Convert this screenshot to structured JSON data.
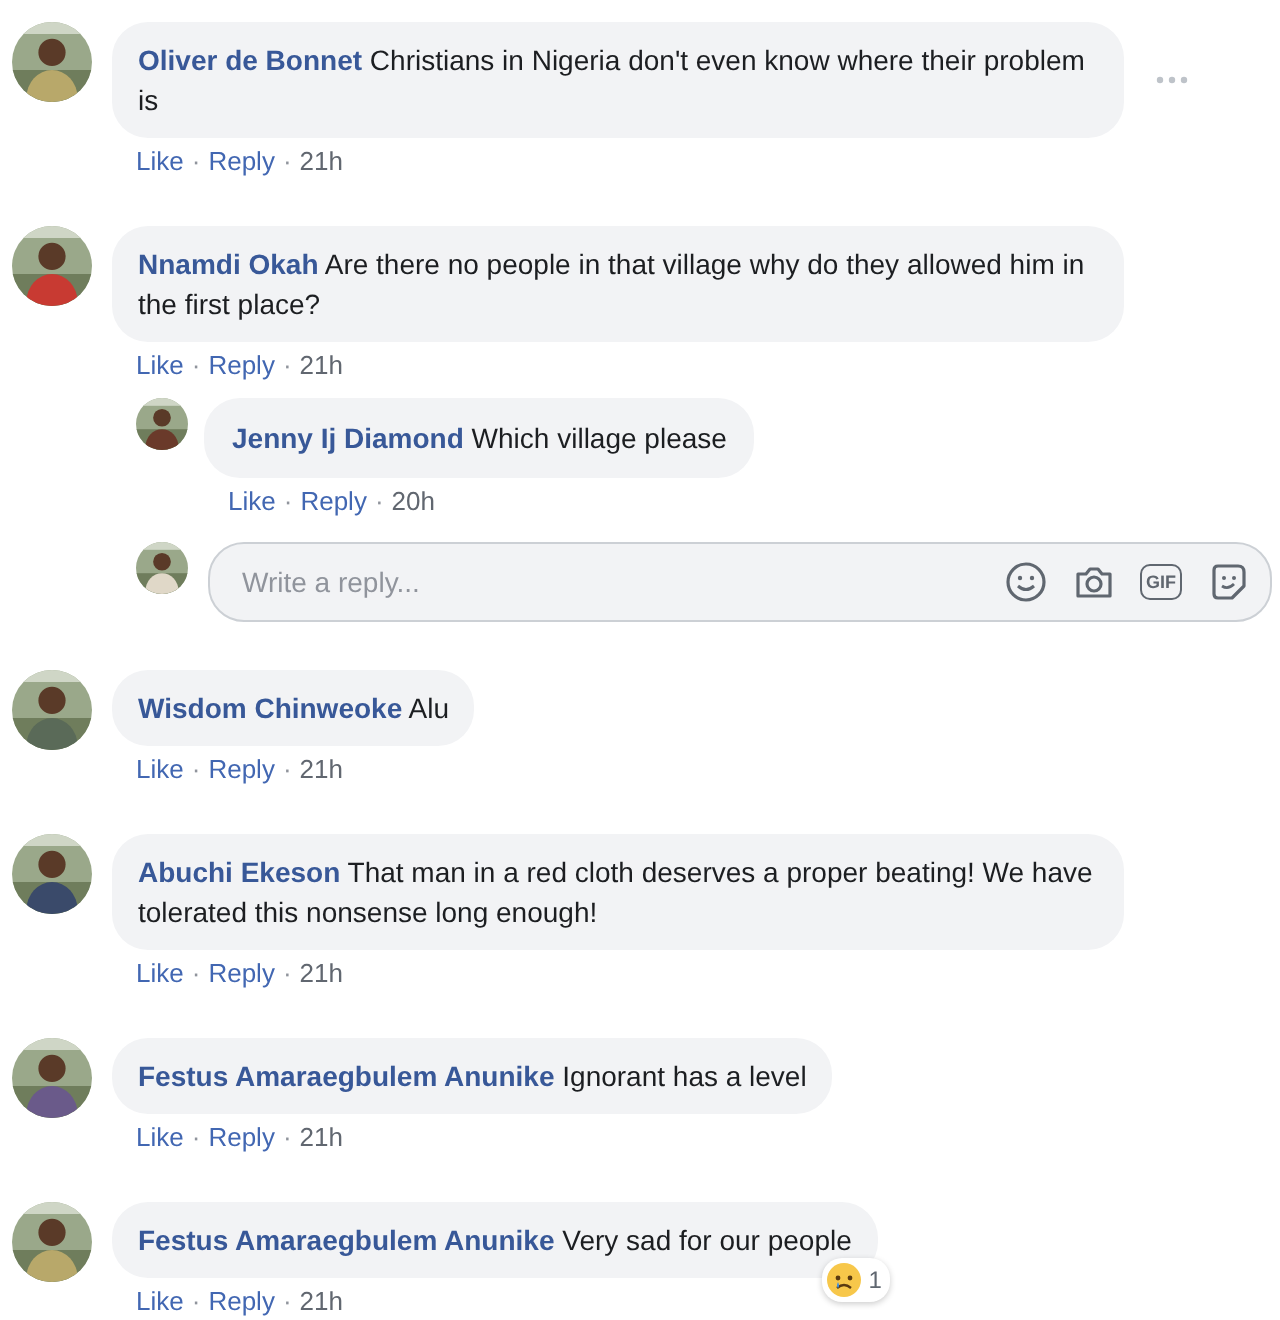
{
  "separator": "·",
  "comments": [
    {
      "author": "Oliver de Bonnet",
      "text": "Christians in Nigeria don't even know where their problem is",
      "more_options": true,
      "actions": [
        {
          "kind": "link",
          "text": "Like"
        },
        {
          "kind": "link",
          "text": "Reply"
        },
        {
          "kind": "time",
          "text": "21h"
        }
      ]
    },
    {
      "author": "Nnamdi Okah",
      "text": "Are there no people in that village why do they allowed him in the first place?",
      "actions": [
        {
          "kind": "link",
          "text": "Like"
        },
        {
          "kind": "link",
          "text": "Reply"
        },
        {
          "kind": "time",
          "text": "21h"
        }
      ],
      "replies": [
        {
          "author": "Jenny Ij Diamond",
          "text": "Which village please",
          "actions": [
            {
              "kind": "link",
              "text": "Like"
            },
            {
              "kind": "link",
              "text": "Reply"
            },
            {
              "kind": "time",
              "text": "20h"
            }
          ]
        }
      ],
      "reply_box": {
        "placeholder": "Write a reply...",
        "gif_label": "GIF"
      }
    },
    {
      "author": "Wisdom Chinweoke",
      "text": "Alu",
      "actions": [
        {
          "kind": "link",
          "text": "Like"
        },
        {
          "kind": "link",
          "text": "Reply"
        },
        {
          "kind": "time",
          "text": "21h"
        }
      ]
    },
    {
      "author": "Abuchi Ekeson",
      "text": "That man in a red cloth deserves a proper beating! We have tolerated this nonsense long enough!",
      "actions": [
        {
          "kind": "link",
          "text": "Like"
        },
        {
          "kind": "link",
          "text": "Reply"
        },
        {
          "kind": "time",
          "text": "21h"
        }
      ]
    },
    {
      "author": "Festus Amaraegbulem Anunike",
      "text": "Ignorant has a level",
      "actions": [
        {
          "kind": "link",
          "text": "Like"
        },
        {
          "kind": "link",
          "text": "Reply"
        },
        {
          "kind": "time",
          "text": "21h"
        }
      ]
    },
    {
      "author": "Festus Amaraegbulem Anunike",
      "text": "Very sad for our people",
      "actions": [
        {
          "kind": "link",
          "text": "Like"
        },
        {
          "kind": "link",
          "text": "Reply"
        },
        {
          "kind": "time",
          "text": "21h"
        }
      ],
      "reactions": {
        "kind": "sad",
        "count": "1"
      }
    }
  ]
}
